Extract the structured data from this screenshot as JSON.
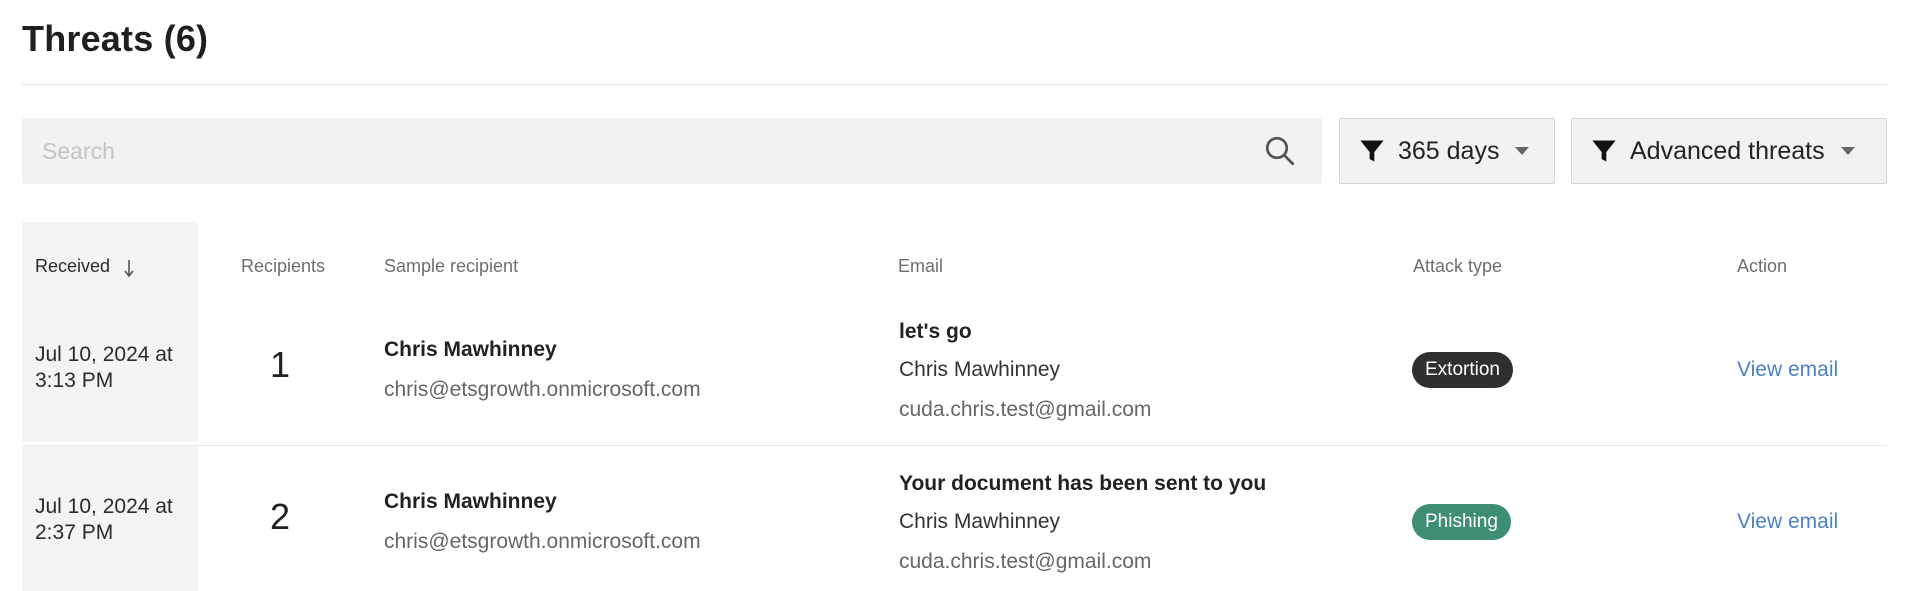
{
  "page": {
    "title": "Threats (6)"
  },
  "toolbar": {
    "search_placeholder": "Search",
    "days_filter_label": "365 days",
    "type_filter_label": "Advanced threats"
  },
  "table": {
    "headers": {
      "received": "Received",
      "recipients": "Recipients",
      "sample_recipient": "Sample recipient",
      "email": "Email",
      "attack_type": "Attack type",
      "action": "Action"
    },
    "sort": {
      "column": "received",
      "direction": "descending"
    },
    "rows": [
      {
        "received": "Jul 10, 2024 at 3:13 PM",
        "recipients": "1",
        "recipient_name": "Chris Mawhinney",
        "recipient_email": "chris@etsgrowth.onmicrosoft.com",
        "email_subject": "let's go",
        "email_sender": "Chris Mawhinney",
        "email_address": "cuda.chris.test@gmail.com",
        "attack_type": "Extortion",
        "action": "View email"
      },
      {
        "received": "Jul 10, 2024 at 2:37 PM",
        "recipients": "2",
        "recipient_name": "Chris Mawhinney",
        "recipient_email": "chris@etsgrowth.onmicrosoft.com",
        "email_subject": "Your document has been sent to you",
        "email_sender": "Chris Mawhinney",
        "email_address": "cuda.chris.test@gmail.com",
        "attack_type": "Phishing",
        "action": "View email"
      }
    ]
  },
  "colors": {
    "extortion_badge": "#2f2f2f",
    "phishing_badge": "#3d8e75",
    "link": "#4a82c4"
  },
  "icons": {
    "search": "search-icon",
    "filter": "filter-icon",
    "caret": "caret-down-icon",
    "sort": "arrow-down-icon"
  }
}
